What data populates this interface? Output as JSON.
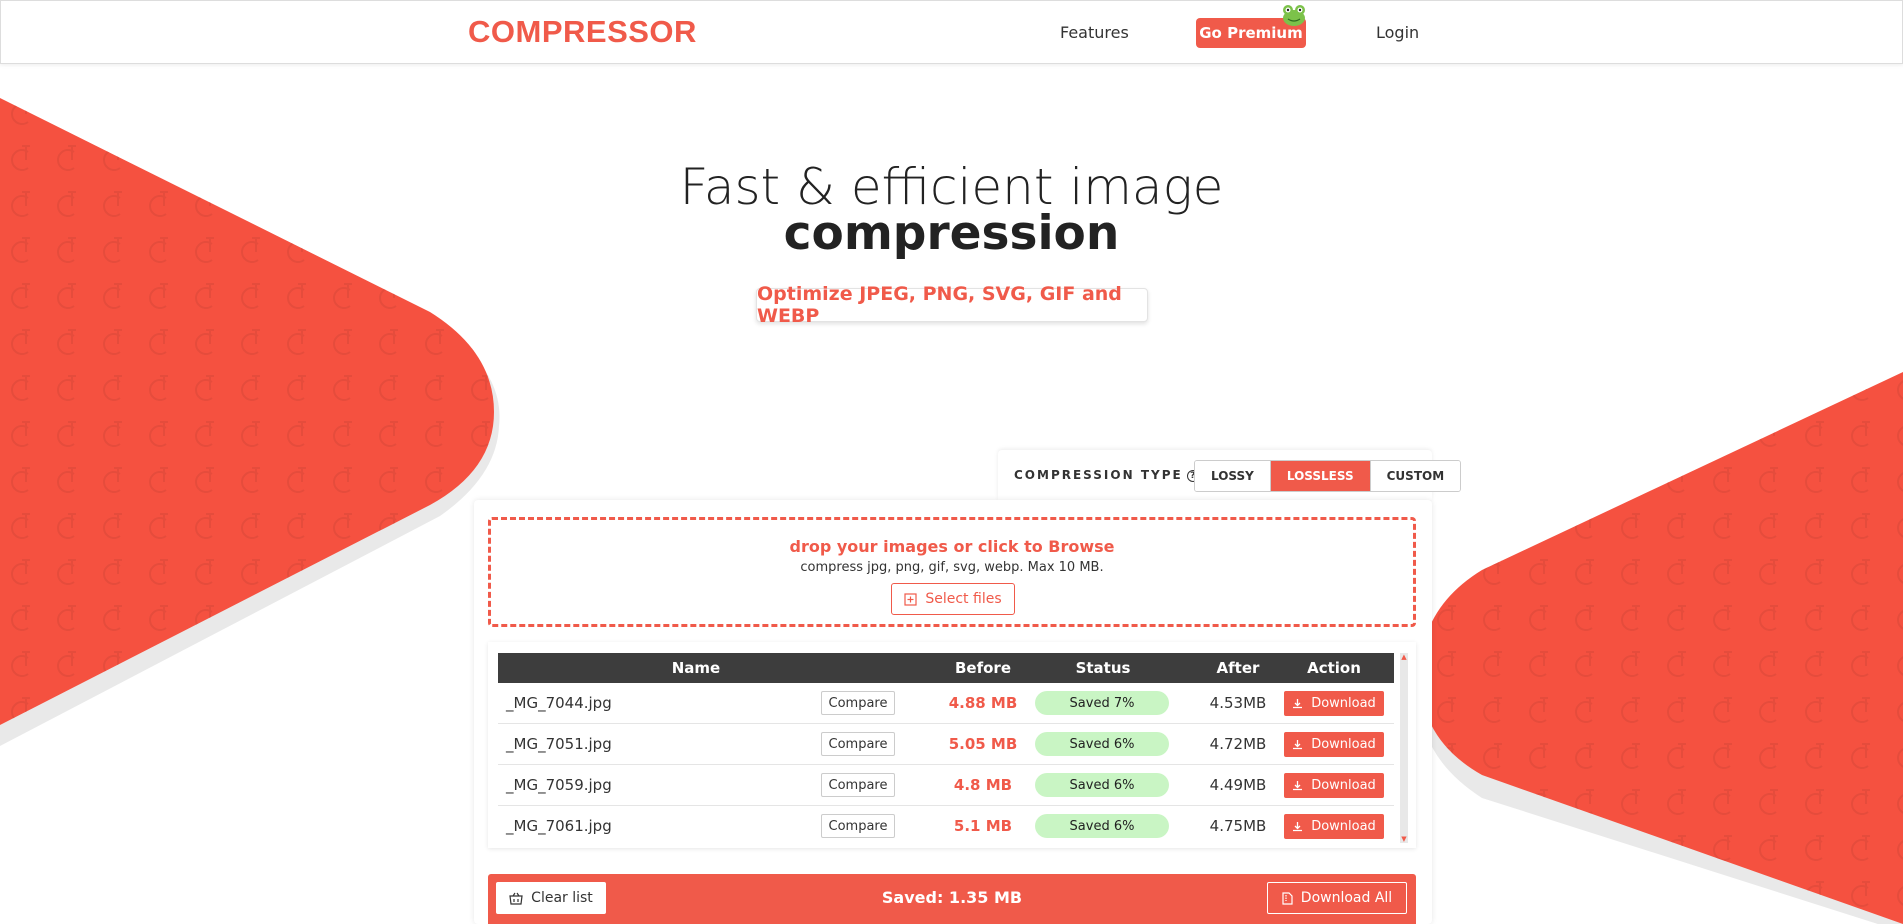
{
  "header": {
    "logo": "COMPRESSOR",
    "nav_features": "Features",
    "nav_premium": "Go Premium",
    "nav_login": "Login"
  },
  "hero": {
    "line1": "Fast & efficient image",
    "line2": "compression",
    "subtitle": "Optimize JPEG, PNG, SVG, GIF and WEBP"
  },
  "compression_type": {
    "label": "COMPRESSION TYPE",
    "help": "?",
    "options": [
      "LOSSY",
      "LOSSLESS",
      "CUSTOM"
    ],
    "selected": "LOSSLESS"
  },
  "dropzone": {
    "title": "drop your images or click to Browse",
    "subtitle": "compress jpg, png, gif, svg, webp. Max 10 MB.",
    "select_label": "Select files"
  },
  "table": {
    "headers": {
      "name": "Name",
      "before": "Before",
      "status": "Status",
      "after": "After",
      "action": "Action"
    },
    "compare_label": "Compare",
    "download_label": "Download",
    "rows": [
      {
        "name": "_MG_7044.jpg",
        "before": "4.88 MB",
        "status": "Saved 7%",
        "after": "4.53MB"
      },
      {
        "name": "_MG_7051.jpg",
        "before": "5.05 MB",
        "status": "Saved 6%",
        "after": "4.72MB"
      },
      {
        "name": "_MG_7059.jpg",
        "before": "4.8 MB",
        "status": "Saved 6%",
        "after": "4.49MB"
      },
      {
        "name": "_MG_7061.jpg",
        "before": "5.1 MB",
        "status": "Saved 6%",
        "after": "4.75MB"
      }
    ]
  },
  "footer": {
    "clear_label": "Clear list",
    "saved_text": "Saved: 1.35 MB",
    "download_all_label": "Download All"
  },
  "colors": {
    "accent": "#f05a4a",
    "table_header": "#3d3d3d",
    "status_bg": "#c9f5c4"
  }
}
